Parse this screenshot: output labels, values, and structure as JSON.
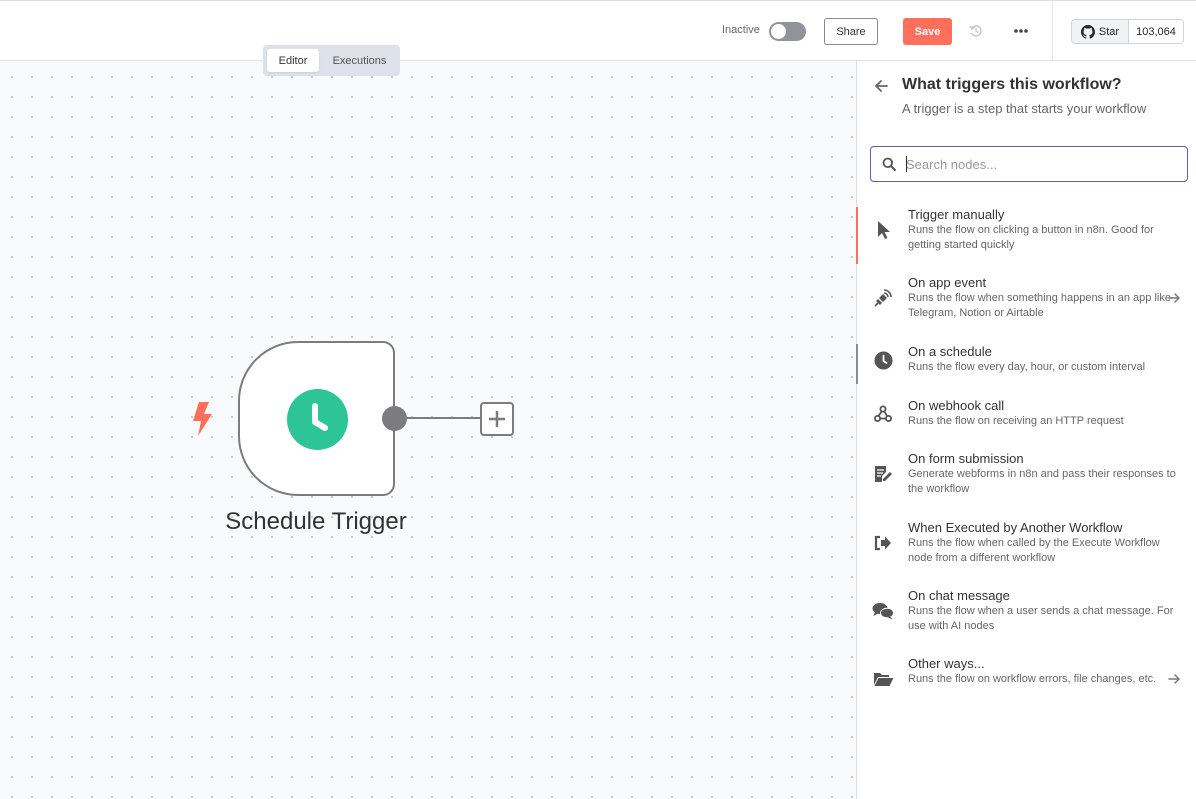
{
  "header": {
    "status_label": "Inactive",
    "share_label": "Share",
    "save_label": "Save",
    "github": {
      "star_label": "Star",
      "star_count": "103,064"
    }
  },
  "tabs": [
    {
      "label": "Editor",
      "active": true
    },
    {
      "label": "Executions",
      "active": false
    }
  ],
  "canvas": {
    "node": {
      "label": "Schedule Trigger",
      "icon": "clock-icon",
      "color": "#2dc598"
    },
    "trigger_icon_color": "#ff6f5c"
  },
  "panel": {
    "title": "What triggers this workflow?",
    "subtitle": "A trigger is a step that starts your workflow",
    "search": {
      "placeholder": "Search nodes...",
      "value": ""
    },
    "items": [
      {
        "title": "Trigger manually",
        "desc": "Runs the flow on clicking a button in n8n. Good for getting started quickly",
        "icon": "cursor-icon",
        "has_arrow": false
      },
      {
        "title": "On app event",
        "desc": "Runs the flow when something happens in an app like Telegram, Notion or Airtable",
        "icon": "satellite-icon",
        "has_arrow": true
      },
      {
        "title": "On a schedule",
        "desc": "Runs the flow every day, hour, or custom interval",
        "icon": "clock-icon",
        "has_arrow": false
      },
      {
        "title": "On webhook call",
        "desc": "Runs the flow on receiving an HTTP request",
        "icon": "webhook-icon",
        "has_arrow": false
      },
      {
        "title": "On form submission",
        "desc": "Generate webforms in n8n and pass their responses to the workflow",
        "icon": "form-icon",
        "has_arrow": false
      },
      {
        "title": "When Executed by Another Workflow",
        "desc": "Runs the flow when called by the Execute Workflow node from a different workflow",
        "icon": "sign-in-icon",
        "has_arrow": false
      },
      {
        "title": "On chat message",
        "desc": "Runs the flow when a user sends a chat message. For use with AI nodes",
        "icon": "chat-icon",
        "has_arrow": false
      },
      {
        "title": "Other ways...",
        "desc": "Runs the flow on workflow errors, file changes, etc.",
        "icon": "folder-open-icon",
        "has_arrow": true
      }
    ]
  }
}
